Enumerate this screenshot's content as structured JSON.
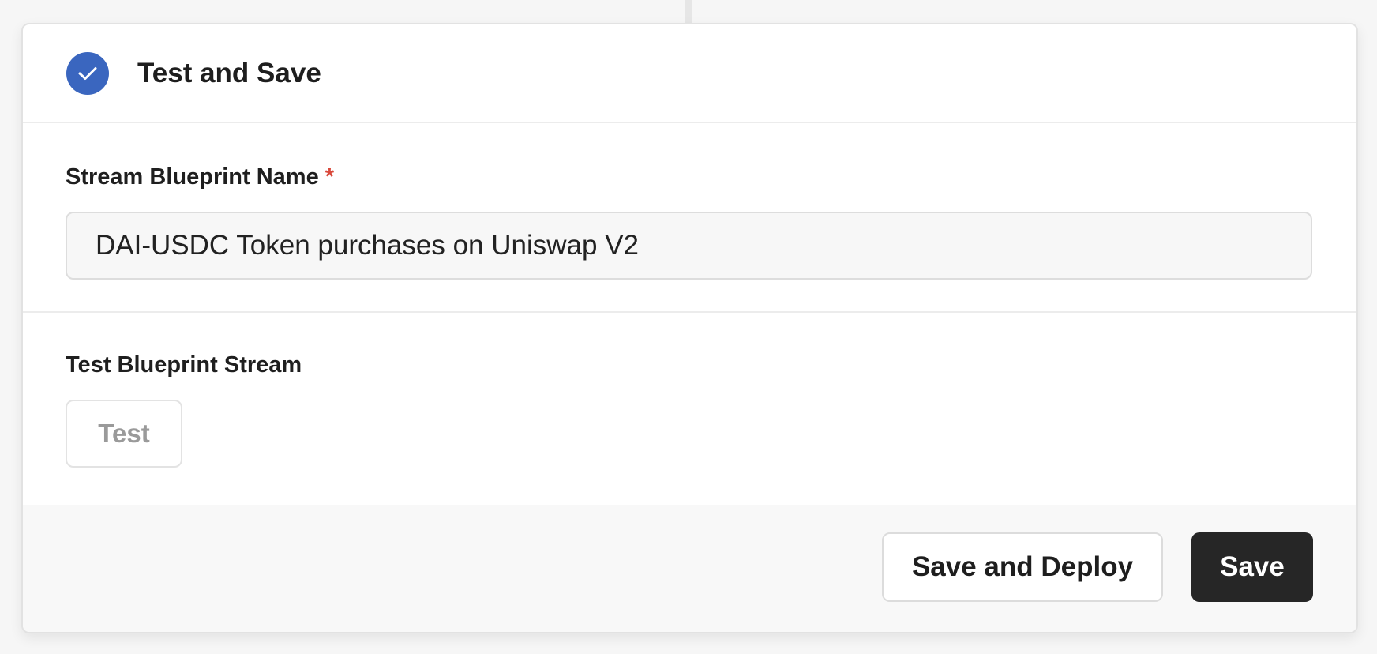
{
  "header": {
    "title": "Test and Save",
    "status_icon": "check-icon",
    "accent_color": "#3a66bf"
  },
  "name_section": {
    "label": "Stream Blueprint Name",
    "required_marker": "*",
    "input_value": "DAI-USDC Token purchases on Uniswap V2"
  },
  "test_section": {
    "label": "Test Blueprint Stream",
    "test_button_label": "Test"
  },
  "footer": {
    "save_deploy_label": "Save and Deploy",
    "save_label": "Save"
  }
}
